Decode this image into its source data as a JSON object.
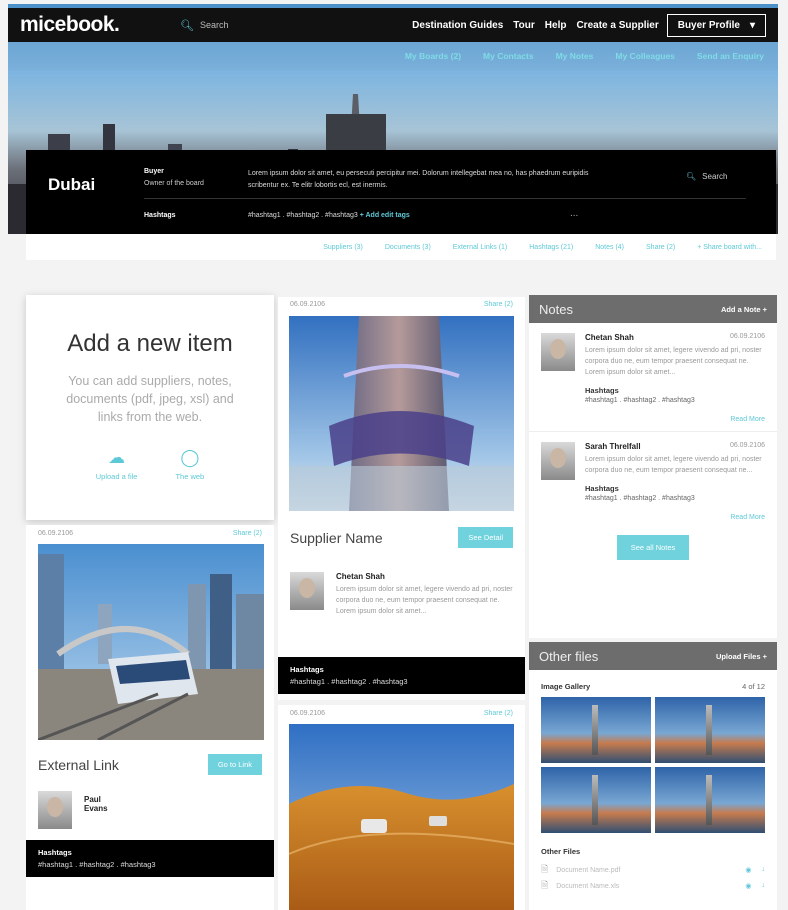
{
  "header": {
    "logo": "micebook.",
    "search_placeholder": "Search",
    "nav": [
      "Destination Guides",
      "Tour",
      "Help",
      "Create a Supplier"
    ],
    "profile_button": "Buyer Profile",
    "subnav": [
      "My Boards (2)",
      "My Contacts",
      "My Notes",
      "My Colleagues",
      "Send an Enquiry"
    ]
  },
  "board": {
    "city": "Dubai",
    "buyer_label": "Buyer",
    "buyer_sub": "Owner of the board",
    "description": "Lorem ipsum dolor sit amet, eu persecuti percipitur mei. Dolorum intellegebat mea no, has phaedrum euripidis scribentur ex. Te elitr lobortis ecl, est inermis.",
    "hashtags_label": "Hashtags",
    "hashtags": "#hashtag1 . #hashtag2 . #hashtag3",
    "add_tags": "+ Add edit tags",
    "more": "...",
    "search_placeholder": "Search"
  },
  "tabs": [
    "Suppliers (3)",
    "Documents (3)",
    "External Links (1)",
    "Hashtags (21)",
    "Notes (4)",
    "Share (2)",
    "+ Share board with..."
  ],
  "add_card": {
    "title": "Add a new item",
    "text": "You can add suppliers, notes, documents (pdf, jpeg, xsl) and links from the web.",
    "upload": "Upload a file",
    "web": "The web"
  },
  "col1_card": {
    "date": "06.09.2106",
    "share": "Share (2)",
    "title": "External Link",
    "button": "Go to Link",
    "person_name": "Paul\nEvans",
    "hashtags_label": "Hashtags",
    "hashtags": "#hashtag1 . #hashtag2 . #hashtag3"
  },
  "col2_card": {
    "date": "06.09.2106",
    "share": "Share (2)",
    "title": "Supplier Name",
    "button": "See Detail",
    "person_name": "Chetan Shah",
    "person_text": "Lorem ipsum dolor sit amet, legere vivendo ad pri, noster corpora duo ne, eum tempor praesent consequat ne. Lorem ipsum dolor sit amet...",
    "hashtags_label": "Hashtags",
    "hashtags": "#hashtag1 . #hashtag2 . #hashtag3"
  },
  "col2_card2": {
    "date": "06.09.2106",
    "share": "Share (2)"
  },
  "notes": {
    "title": "Notes",
    "add": "Add a Note +",
    "items": [
      {
        "name": "Chetan Shah",
        "date": "06.09.2106",
        "text": "Lorem ipsum dolor sit amet, legere vivendo ad pri, noster corpora duo ne, eum tempor praesent consequat ne. Lorem ipsum dolor sit amet...",
        "hashtags_label": "Hashtags",
        "hashtags": "#hashtag1 . #hashtag2 . #hashtag3",
        "read_more": "Read More"
      },
      {
        "name": "Sarah Threlfall",
        "date": "06.09.2106",
        "text": "Lorem ipsum dolor sit amet, legere vivendo ad pri, noster corpora duo ne, eum tempor praesent consequat ne...",
        "hashtags_label": "Hashtags",
        "hashtags": "#hashtag1 . #hashtag2 . #hashtag3",
        "read_more": "Read More"
      }
    ],
    "see_all": "See all Notes"
  },
  "files": {
    "title": "Other files",
    "upload": "Upload Files +",
    "gallery_label": "Image Gallery",
    "gallery_count": "4 of 12",
    "other_label": "Other Files",
    "docs": [
      "Document Name.pdf",
      "Document Name.xls"
    ]
  },
  "colors": {
    "accent": "#5ec9d6",
    "dark": "#000000",
    "panel": "#6d6d6d"
  }
}
